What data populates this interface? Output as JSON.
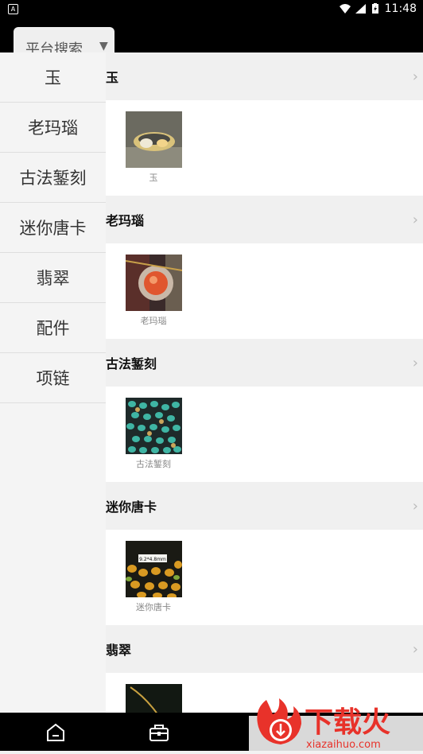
{
  "status_bar": {
    "left_icon": "notification-icon",
    "time": "11:48",
    "icons": [
      "wifi-icon",
      "signal-icon",
      "battery-icon"
    ]
  },
  "header": {
    "search_tab_label": "平台搜索",
    "caret": "▼"
  },
  "sidebar": {
    "items": [
      "玉",
      "老玛瑙",
      "古法錾刻",
      "迷你唐卡",
      "翡翠",
      "配件",
      "项链"
    ]
  },
  "sections": [
    {
      "title": "玉",
      "item_label": "玉",
      "image": "jade-ring-photo"
    },
    {
      "title": "老玛瑙",
      "item_label": "老玛瑙",
      "image": "agate-bead-photo"
    },
    {
      "title": "古法錾刻",
      "item_label": "古法錾刻",
      "image": "turquoise-beads-photo"
    },
    {
      "title": "迷你唐卡",
      "item_label": "迷你唐卡",
      "image": "thangka-beads-photo",
      "photo_tag": "9.2*4.8mm"
    },
    {
      "title": "翡翠",
      "item_label": "",
      "image": "jade-pendant-photo"
    }
  ],
  "chevron": "›",
  "bottom_nav": {
    "icons": [
      "home-icon",
      "shop-icon"
    ]
  },
  "watermark": {
    "text": "下载火",
    "url": "xiazaihuo.com"
  },
  "colors": {
    "status_bar": "#000000",
    "sidebar_bg": "#f4f4f4",
    "section_bg": "#ffffff",
    "watermark_red": "#e8322a"
  }
}
